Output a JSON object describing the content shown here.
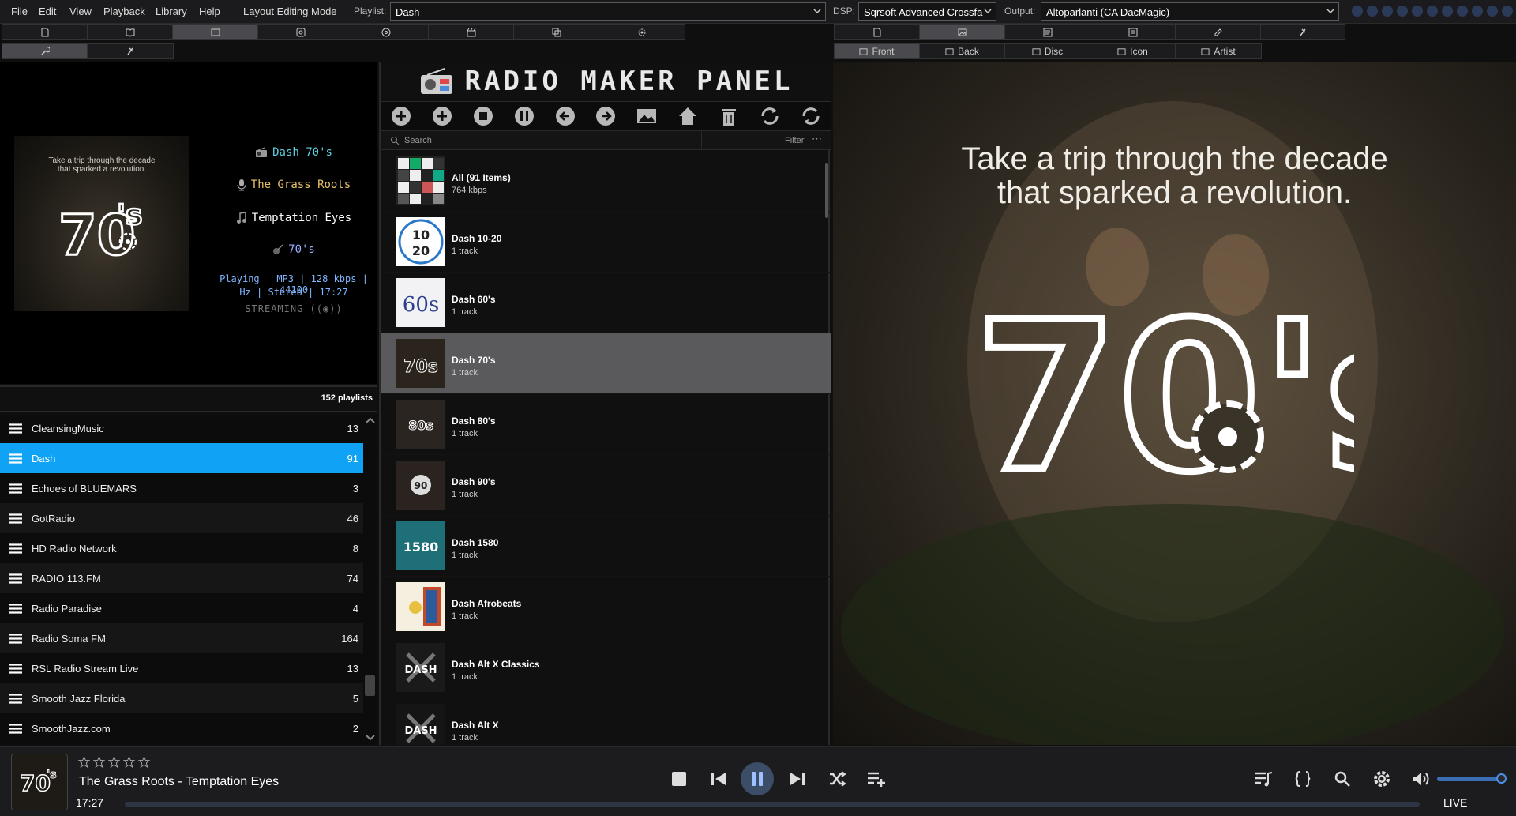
{
  "menu": {
    "file": "File",
    "edit": "Edit",
    "view": "View",
    "playback": "Playback",
    "library": "Library",
    "help": "Help",
    "layout": "Layout Editing Mode"
  },
  "toolbar": {
    "playlist_label": "Playlist:",
    "playlist_value": "Dash",
    "dsp_label": "DSP:",
    "dsp_value": "Sqrsoft Advanced Crossfa",
    "output_label": "Output:",
    "output_value": "Altoparlanti (CA DacMagic)"
  },
  "art_tabs": {
    "front": "Front",
    "back": "Back",
    "disc": "Disc",
    "icon": "Icon",
    "artist": "Artist"
  },
  "now_playing": {
    "station": "Dash 70's",
    "artist": "The Grass Roots",
    "title": "Temptation Eyes",
    "genre": "70's",
    "info_line1": "Playing | MP3 | 128 kbps | 44100",
    "info_line2": "Hz | Stereo | 17:27",
    "streaming": "STREAMING ((◉))"
  },
  "artwork": {
    "caption_line1": "Take a trip through the decade",
    "caption_line2": "that sparked a revolution.",
    "logo_text": "70's"
  },
  "playlists": {
    "count_label": "152 playlists",
    "items": [
      {
        "name": "CleansingMusic",
        "count": "13"
      },
      {
        "name": "Dash",
        "count": "91"
      },
      {
        "name": "Echoes of BLUEMARS",
        "count": "3"
      },
      {
        "name": "GotRadio",
        "count": "46"
      },
      {
        "name": "HD Radio Network",
        "count": "8"
      },
      {
        "name": "RADIO 113.FM",
        "count": "74"
      },
      {
        "name": "Radio Paradise",
        "count": "4"
      },
      {
        "name": "Radio Soma FM",
        "count": "164"
      },
      {
        "name": "RSL Radio Stream Live",
        "count": "13"
      },
      {
        "name": "Smooth Jazz Florida",
        "count": "5"
      },
      {
        "name": "SmoothJazz.com",
        "count": "2"
      }
    ]
  },
  "radio_maker": {
    "title": "RADIO MAKER PANEL",
    "search_placeholder": "Search",
    "filter_label": "Filter",
    "items": [
      {
        "title": "All (91 Items)",
        "sub": "764 kbps",
        "thumb": "grid"
      },
      {
        "title": "Dash 10-20",
        "sub": "1 track",
        "thumb": "1020"
      },
      {
        "title": "Dash 60's",
        "sub": "1 track",
        "thumb": "60s"
      },
      {
        "title": "Dash 70's",
        "sub": "1 track",
        "thumb": "70s"
      },
      {
        "title": "Dash 80's",
        "sub": "1 track",
        "thumb": "80s"
      },
      {
        "title": "Dash 90's",
        "sub": "1 track",
        "thumb": "90s"
      },
      {
        "title": "Dash 1580",
        "sub": "1 track",
        "thumb": "1580"
      },
      {
        "title": "Dash Afrobeats",
        "sub": "1 track",
        "thumb": "afro"
      },
      {
        "title": "Dash Alt X Classics",
        "sub": "1 track",
        "thumb": "altx"
      },
      {
        "title": "Dash Alt X",
        "sub": "1 track",
        "thumb": "altx2"
      }
    ]
  },
  "player": {
    "track": "The Grass Roots - Temptation Eyes",
    "time": "17:27",
    "live": "LIVE",
    "rating": 0,
    "volume_percent": 92
  },
  "colors": {
    "selection": "#0fa2f5",
    "accent": "#4c8ee8",
    "gold": "#e8c26b",
    "cyan": "#5dcfe0"
  }
}
